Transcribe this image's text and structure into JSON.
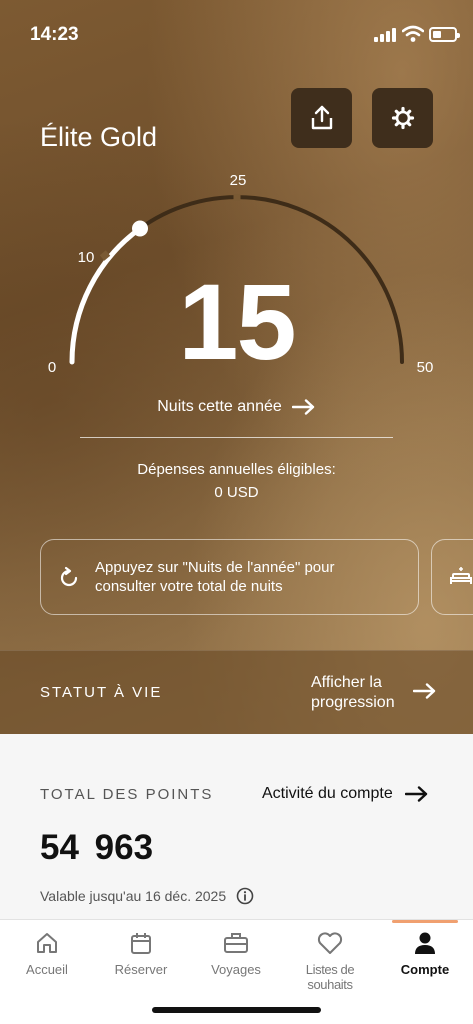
{
  "status_bar": {
    "time": "14:23"
  },
  "header": {
    "tier": "Élite Gold"
  },
  "gauge": {
    "value": 15,
    "display": "15",
    "max": 50,
    "labels": {
      "min": "0",
      "mark1": "10",
      "mark2": "25",
      "max": "50"
    }
  },
  "nights_link": "Nuits cette année",
  "spend": {
    "label": "Dépenses annuelles éligibles:",
    "value": "0 USD"
  },
  "info_card": {
    "text": "Appuyez sur \"Nuits de l'année\" pour consulter votre total de nuits"
  },
  "lifetime": {
    "title": "STATUT À VIE",
    "link": "Afficher la progression"
  },
  "points": {
    "title": "TOTAL DES POINTS",
    "activity_link": "Activité du compte",
    "value": "54 963",
    "valid_until": "Valable jusqu'au 16 déc. 2025"
  },
  "tabbar": {
    "items": [
      {
        "label": "Accueil",
        "icon": "home-icon"
      },
      {
        "label": "Réserver",
        "icon": "calendar-icon"
      },
      {
        "label": "Voyages",
        "icon": "suitcase-icon"
      },
      {
        "label": "Listes de souhaits",
        "icon": "heart-icon"
      },
      {
        "label": "Compte",
        "icon": "person-icon",
        "active": true
      }
    ]
  },
  "colors": {
    "accent": "#f0a070",
    "hero": "#7d5a32",
    "button_dark": "#3f2e1c"
  }
}
